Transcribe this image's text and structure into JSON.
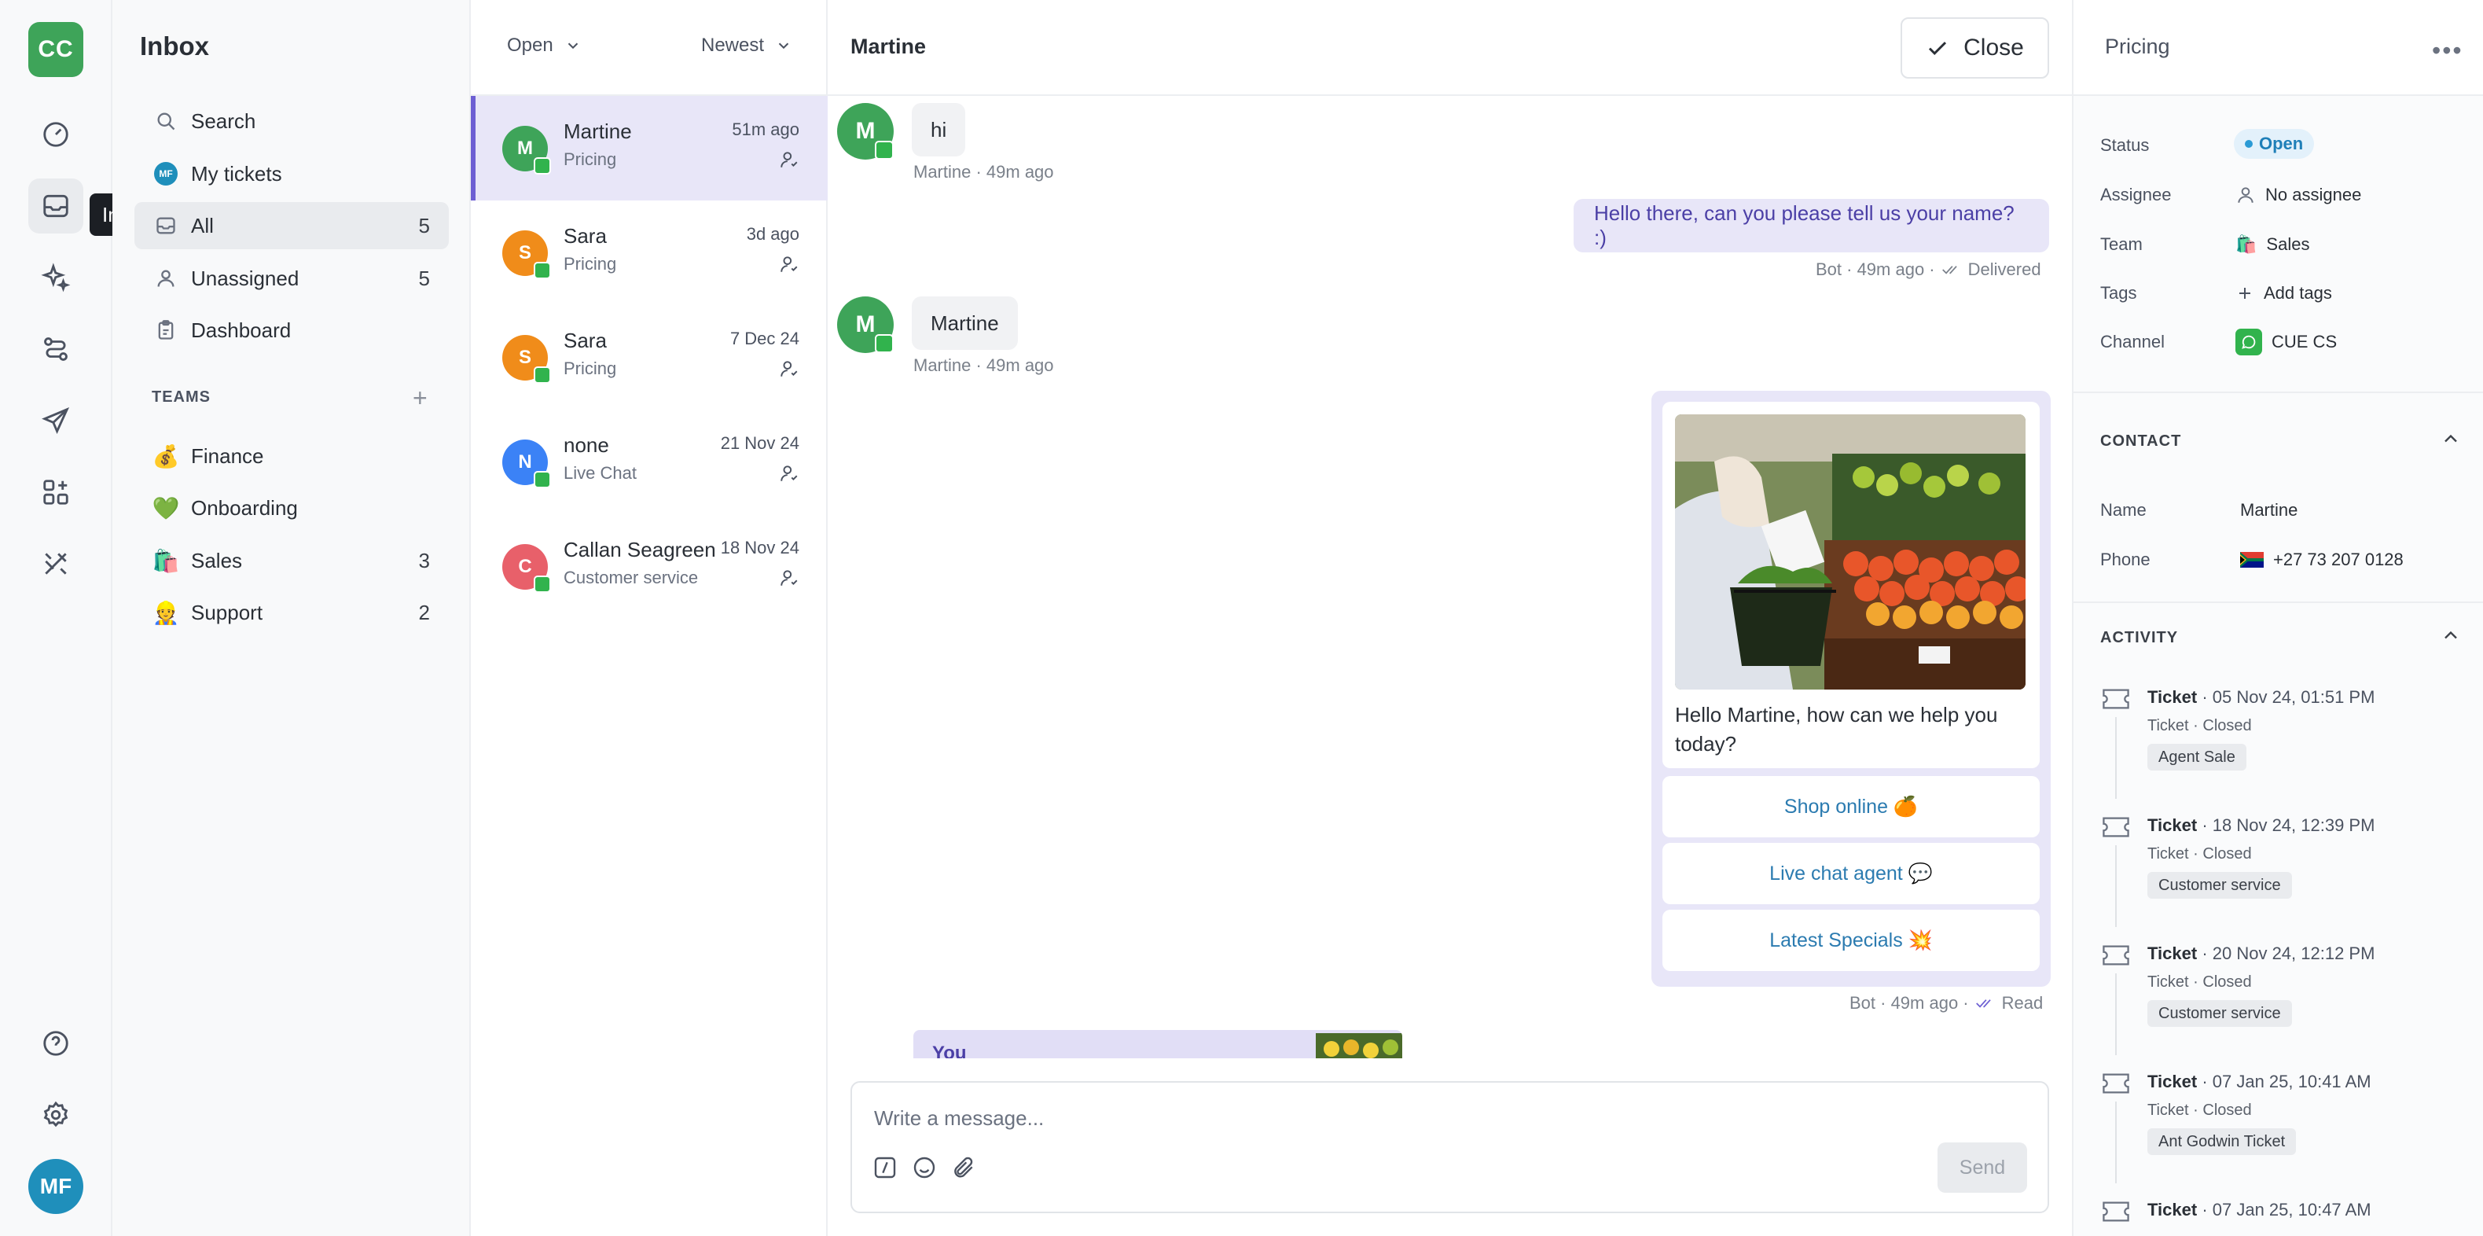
{
  "rail": {
    "workspace_initials": "CC",
    "tooltip": "Inbox",
    "user_initials": "MF",
    "icons": [
      "dashboard-gauge-icon",
      "inbox-icon",
      "sparkles-icon",
      "flows-icon",
      "send-icon",
      "apps-grid-icon",
      "tools-icon",
      "help-icon",
      "settings-icon"
    ]
  },
  "nav": {
    "title": "Inbox",
    "items": [
      {
        "label": "Search",
        "count": ""
      },
      {
        "label": "My tickets",
        "count": ""
      },
      {
        "label": "All",
        "count": "5"
      },
      {
        "label": "Unassigned",
        "count": "5"
      },
      {
        "label": "Dashboard",
        "count": ""
      }
    ],
    "teams_header": "TEAMS",
    "my_tickets_avatar": "MF",
    "teams": [
      {
        "emoji": "💰",
        "label": "Finance",
        "count": ""
      },
      {
        "emoji": "💚",
        "label": "Onboarding",
        "count": ""
      },
      {
        "emoji": "🛍️",
        "label": "Sales",
        "count": "3"
      },
      {
        "emoji": "👷",
        "label": "Support",
        "count": "2"
      }
    ]
  },
  "conv_list": {
    "status_filter": "Open",
    "sort": "Newest",
    "conversations": [
      {
        "initial": "M",
        "name": "Martine",
        "subtitle": "Pricing",
        "time": "51m ago",
        "color": "#3ea459"
      },
      {
        "initial": "S",
        "name": "Sara",
        "subtitle": "Pricing",
        "time": "3d ago",
        "color": "#f08c1a"
      },
      {
        "initial": "S",
        "name": "Sara",
        "subtitle": "Pricing",
        "time": "7 Dec 24",
        "color": "#f08c1a"
      },
      {
        "initial": "N",
        "name": "none",
        "subtitle": "Live Chat",
        "time": "21 Nov 24",
        "color": "#3b82f6"
      },
      {
        "initial": "C",
        "name": "Callan Seagreen",
        "subtitle": "Customer service",
        "time": "18 Nov 24",
        "color": "#e8606a"
      }
    ]
  },
  "chat": {
    "title": "Martine",
    "close_label": "Close",
    "messages": {
      "m1": {
        "initial": "M",
        "text": "hi",
        "meta": "Martine · 49m ago"
      },
      "m2": {
        "text": "Hello there, can you please tell us your name? :)",
        "meta_sender": "Bot · 49m ago ·",
        "meta_status": "Delivered"
      },
      "m3": {
        "initial": "M",
        "text": "Martine",
        "meta": "Martine · 49m ago"
      },
      "m4": {
        "text": "Hello Martine, how can we help you today?",
        "buttons": [
          "Shop online 🍊",
          "Live chat agent 💬",
          "Latest Specials 💥"
        ],
        "meta_sender": "Bot · 49m ago ·",
        "meta_status": "Read"
      },
      "peek_text": "You"
    },
    "composer": {
      "placeholder": "Write a message...",
      "send_label": "Send"
    }
  },
  "panel": {
    "title": "Pricing",
    "props": {
      "status_label": "Status",
      "status_value": "Open",
      "assignee_label": "Assignee",
      "assignee_value": "No assignee",
      "team_label": "Team",
      "team_emoji": "🛍️",
      "team_value": "Sales",
      "tags_label": "Tags",
      "tags_value": "Add tags",
      "channel_label": "Channel",
      "channel_value": "CUE CS"
    },
    "contact": {
      "header": "CONTACT",
      "name_label": "Name",
      "name_value": "Martine",
      "phone_label": "Phone",
      "phone_value": "+27 73 207 0128"
    },
    "activity": {
      "header": "ACTIVITY",
      "items": [
        {
          "title": "Ticket",
          "date": "· 05 Nov 24, 01:51 PM",
          "status": "Ticket · Closed",
          "tag": "Agent Sale"
        },
        {
          "title": "Ticket",
          "date": "· 18 Nov 24, 12:39 PM",
          "status": "Ticket · Closed",
          "tag": "Customer service"
        },
        {
          "title": "Ticket",
          "date": "· 20 Nov 24, 12:12 PM",
          "status": "Ticket · Closed",
          "tag": "Customer service"
        },
        {
          "title": "Ticket",
          "date": "· 07 Jan 25, 10:41 AM",
          "status": "Ticket · Closed",
          "tag": "Ant Godwin Ticket"
        },
        {
          "title": "Ticket",
          "date": "· 07 Jan 25, 10:47 AM",
          "status": "",
          "tag": ""
        }
      ]
    }
  }
}
